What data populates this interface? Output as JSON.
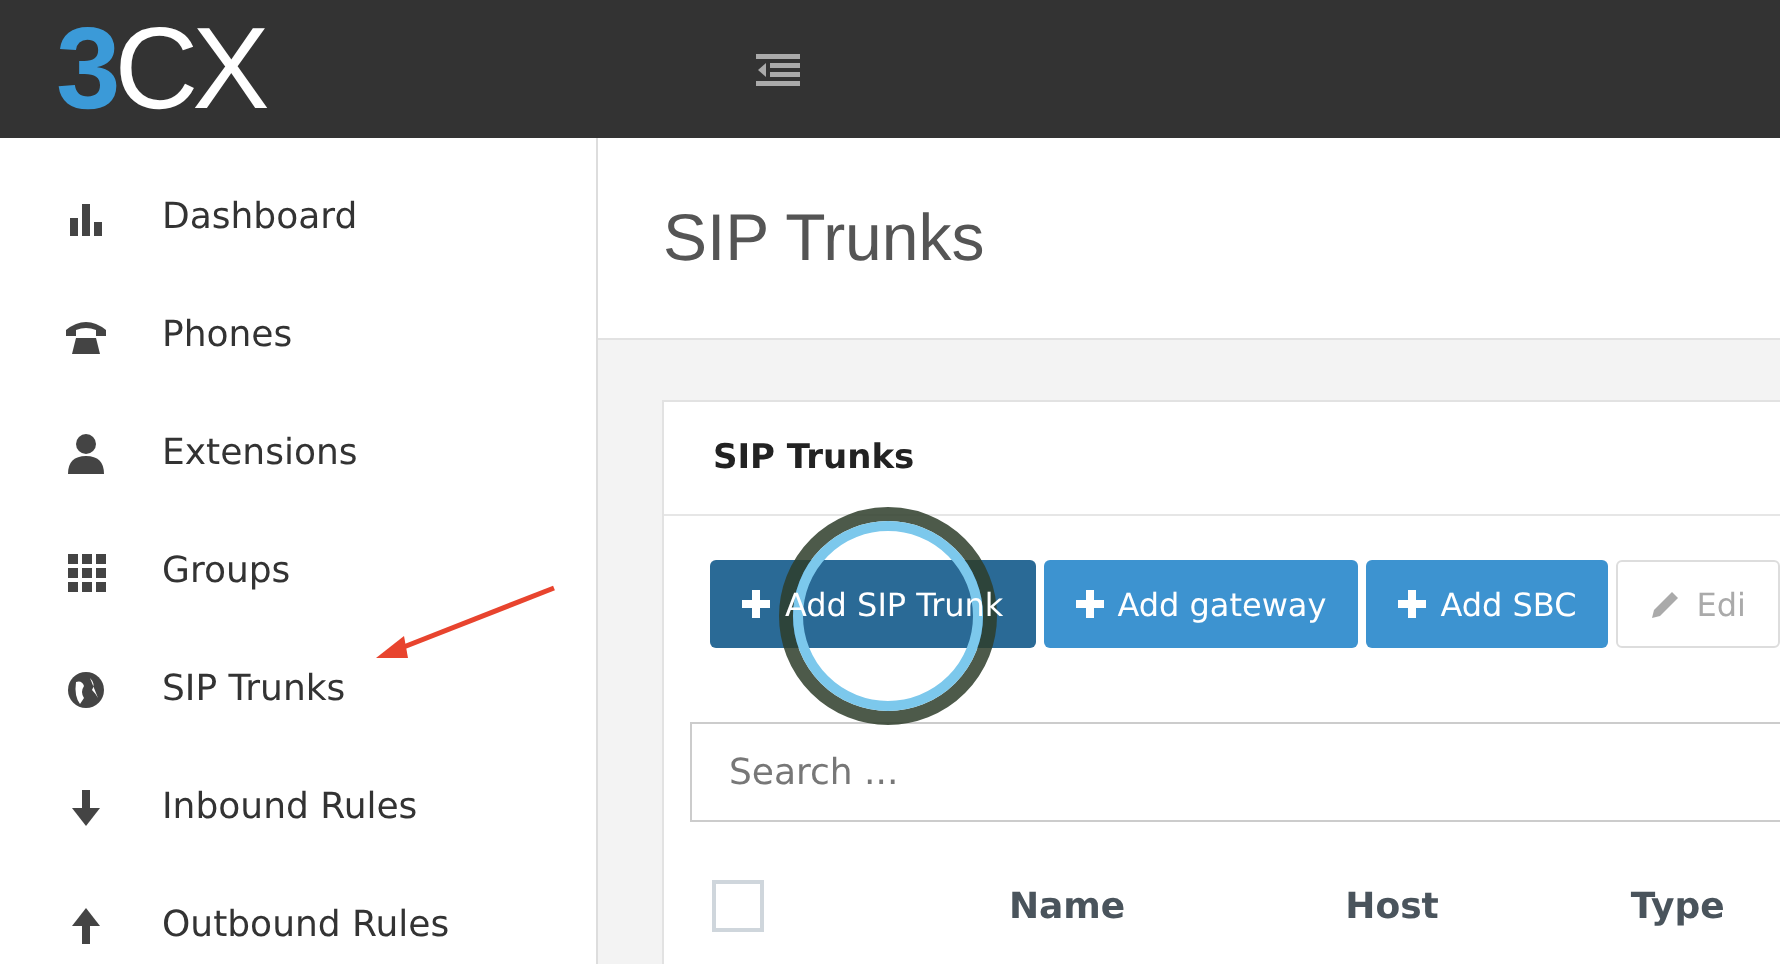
{
  "logo": "3CX",
  "sidebar": {
    "items": [
      {
        "label": "Dashboard",
        "selected": false
      },
      {
        "label": "Phones",
        "selected": false
      },
      {
        "label": "Extensions",
        "selected": false
      },
      {
        "label": "Groups",
        "selected": false
      },
      {
        "label": "SIP Trunks",
        "selected": false
      },
      {
        "label": "Inbound Rules",
        "selected": false
      },
      {
        "label": "Outbound Rules",
        "selected": false
      }
    ]
  },
  "page_title": "SIP Trunks",
  "panel": {
    "title": "SIP Trunks",
    "buttons": [
      {
        "label": "Add SIP Trunk",
        "kind": "primary",
        "pressed": true
      },
      {
        "label": "Add gateway",
        "kind": "primary",
        "pressed": false
      },
      {
        "label": "Add SBC",
        "kind": "primary",
        "pressed": false
      },
      {
        "label": "Edi",
        "kind": "edit",
        "pressed": false
      }
    ],
    "search": {
      "placeholder": "Search ..."
    },
    "table": {
      "columns": [
        "Name",
        "Host",
        "Type"
      ],
      "select_all": {
        "checked": false
      }
    }
  }
}
